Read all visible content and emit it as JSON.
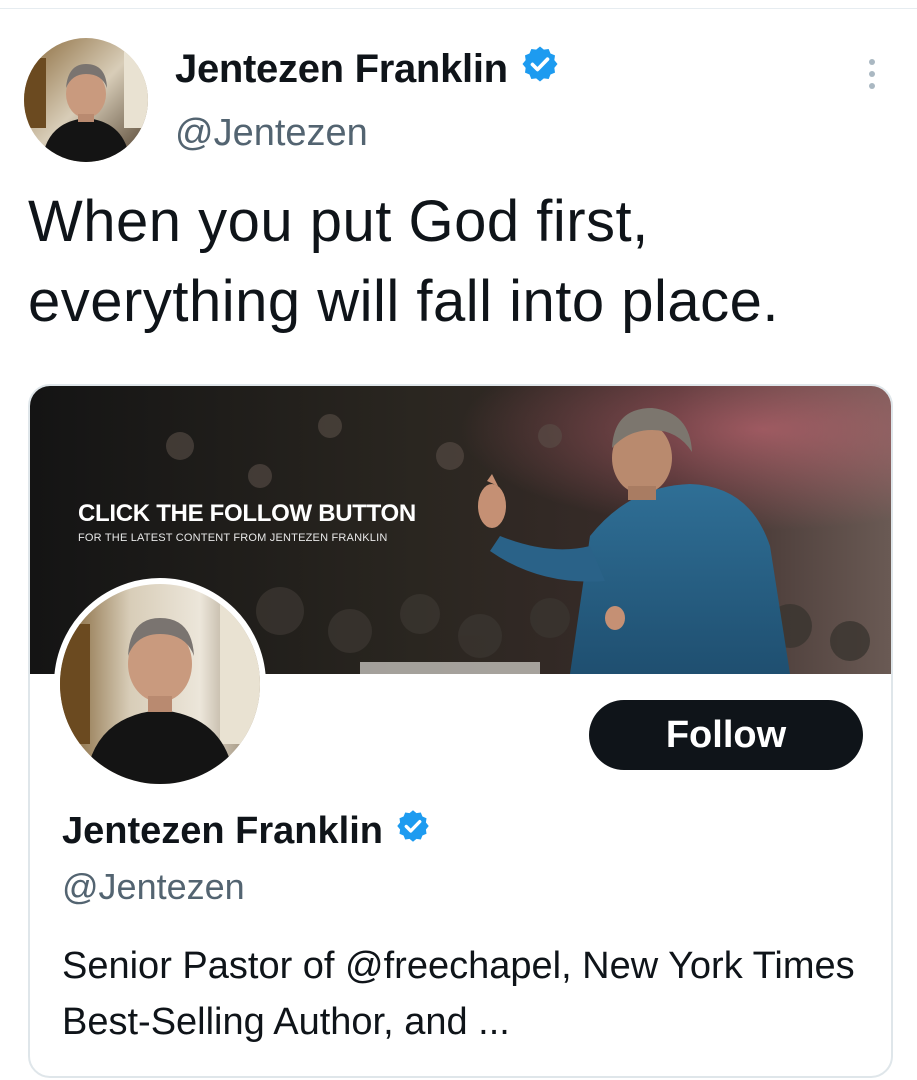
{
  "tweet": {
    "author_name": "Jentezen Franklin",
    "author_handle": "@Jentezen",
    "text": "When you put God first, everything will fall into place.",
    "verified_icon": "verified-badge-icon",
    "more_icon": "more-vertical-icon"
  },
  "card": {
    "banner_title": "CLICK THE FOLLOW BUTTON",
    "banner_subtitle": "FOR THE LATEST CONTENT FROM JENTEZEN FRANKLIN",
    "follow_label": "Follow",
    "name": "Jentezen Franklin",
    "handle": "@Jentezen",
    "bio": "Senior Pastor of @freechapel, New York Times Best-Selling Author, and ..."
  },
  "colors": {
    "verified": "#1d9bf0",
    "follow_button_bg": "#0f1419",
    "handle_text": "#536471"
  }
}
